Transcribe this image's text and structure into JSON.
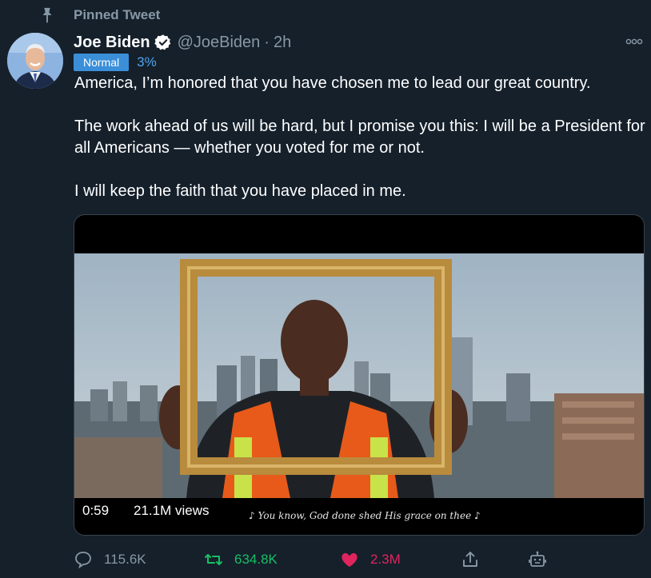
{
  "pinned": {
    "label": "Pinned Tweet",
    "icon": "pin-icon"
  },
  "tweet": {
    "author_name": "Joe Biden",
    "handle": "@JoeBiden",
    "separator": "·",
    "time": "2h",
    "badge": "Normal",
    "percent": "3%",
    "paragraphs": [
      "America, I’m honored that you have chosen me to lead our great country.",
      "The work ahead of us will be hard, but I promise you this: I will be a President for all Americans — whether you voted for me or not.",
      "I will keep the faith that you have placed in me."
    ]
  },
  "video": {
    "duration": "0:59",
    "views": "21.1M views",
    "caption": "♪ You know, God done shed His grace on thee ♪"
  },
  "actions": {
    "replies": "115.6K",
    "retweets": "634.8K",
    "likes": "2.3M"
  },
  "colors": {
    "background": "#15202b",
    "secondary_text": "#8899a6",
    "retweet": "#17bf63",
    "like": "#e0245e",
    "accent": "#1da1f2"
  }
}
